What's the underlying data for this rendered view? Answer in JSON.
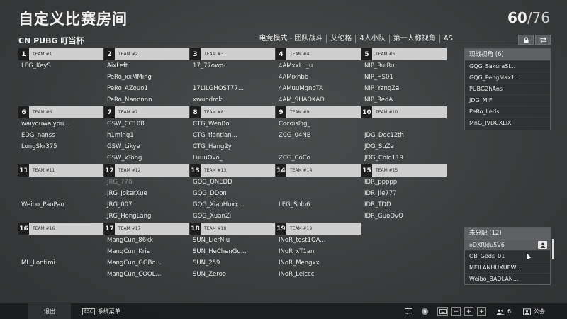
{
  "header": {
    "title": "自定义比赛房间",
    "player_count": "60",
    "player_max": "/76",
    "subtitle": "CN PUBG 叮当杯",
    "modes": [
      "电竞模式 - 团队战斗",
      "艾伦格",
      "4人小队",
      "第一人称视角",
      "AS"
    ],
    "lock_icon": "lock-icon",
    "swap_icon": "swap-icon"
  },
  "teams": [
    {
      "num": "1",
      "label": "TEAM #1",
      "players": [
        "LEG_KeyS",
        "",
        "",
        ""
      ]
    },
    {
      "num": "2",
      "label": "TEAM #2",
      "players": [
        "AixLeft",
        "PeRo_xxMMing",
        "PeRo_AZouo1",
        "PeRo_Nannnnn"
      ]
    },
    {
      "num": "3",
      "label": "TEAM #3",
      "players": [
        "17_77owo-",
        "",
        "17LILGHOST77...",
        "xwuddmk"
      ]
    },
    {
      "num": "4",
      "label": "TEAM #4",
      "players": [
        "4AMxxLu_u",
        "4AMixhbb",
        "4AMuuMgnoTA",
        "4AM_SHAOKAO"
      ]
    },
    {
      "num": "5",
      "label": "TEAM #5",
      "players": [
        "NIP_RuiRui",
        "NIP_HS01",
        "NIP_YangZai",
        "NIP_RedA"
      ]
    },
    {
      "num": "6",
      "label": "TEAM #6",
      "players": [
        "waiyouwaiyou...",
        "EDG_nanss",
        "LongSkr375",
        ""
      ]
    },
    {
      "num": "7",
      "label": "TEAM #7",
      "players": [
        "GSW_CC108",
        "h1ming1",
        "GSW_Likye",
        "GSW_xTong"
      ]
    },
    {
      "num": "8",
      "label": "TEAM #8",
      "players": [
        "CTG_WenBo",
        "CTG_tiantian...",
        "CTG_Hang2y",
        "LuuuOvo_"
      ]
    },
    {
      "num": "9",
      "label": "TEAM #9",
      "players": [
        "CocoisPig_",
        "ZCG_04NB",
        "",
        "ZCG_CoCo"
      ]
    },
    {
      "num": "10",
      "label": "TEAM #10",
      "players": [
        "",
        "JDG_Dec12th",
        "JDG_SuZe",
        "JDG_Cold119"
      ]
    },
    {
      "num": "11",
      "label": "TEAM #11",
      "players": [
        "",
        "",
        "Weibo_PaoPao",
        ""
      ]
    },
    {
      "num": "12",
      "label": "TEAM #12",
      "players": [
        "JRG_778",
        "JRG_JokerXue",
        "JRG_007",
        "JRG_HongLang"
      ]
    },
    {
      "num": "13",
      "label": "TEAM #13",
      "players": [
        "GQG_ONEDD",
        "GQG_DDon",
        "GQG_XiaoHuxx...",
        "GQG_XuanZi"
      ]
    },
    {
      "num": "14",
      "label": "TEAM #14",
      "players": [
        "",
        "",
        "LEG_Solo6",
        ""
      ]
    },
    {
      "num": "15",
      "label": "TEAM #15",
      "players": [
        "IDR_ppppp",
        "IDR_Jie777",
        "IDR_TDD",
        "IDR_GuoQvQ"
      ]
    },
    {
      "num": "16",
      "label": "TEAM #16",
      "players": [
        "",
        "",
        "ML_Lontimi",
        ""
      ]
    },
    {
      "num": "17",
      "label": "TEAM #17",
      "players": [
        "MangCun_86kk",
        "MangCun_Kris",
        "MangCun_GGBo...",
        "MangCun_COOL..."
      ]
    },
    {
      "num": "18",
      "label": "TEAM #18",
      "players": [
        "SUN_LierNiu",
        "SUN_HeChenGu...",
        "SUN_259",
        "SUN_Zeroo"
      ]
    },
    {
      "num": "19",
      "label": "TEAM #19",
      "players": [
        "INoR_test1QA...",
        "INoR_xT1an",
        "INoR_Mengxx",
        "INoR_Leiccc"
      ]
    }
  ],
  "spectators": {
    "title": "观战视角 (6)",
    "items": [
      "GQG_SakuraSi...",
      "GQG_PengMax1...",
      "PUBG2hAns",
      "JDG_MiF",
      "PeRo_Leris",
      "MnG_IVDCXLIX"
    ]
  },
  "unassigned": {
    "title": "未分配 (12)",
    "items": [
      "oDXRkJu5V6",
      "OB_Gods_01",
      "MEILANHUXUEW...",
      "Weibo_BAOLAN..."
    ]
  },
  "footer": {
    "exit_label": "退出",
    "esc_key": "ESC",
    "menu_label": "系统菜单",
    "people_count": "6",
    "announce_label": "公会"
  }
}
